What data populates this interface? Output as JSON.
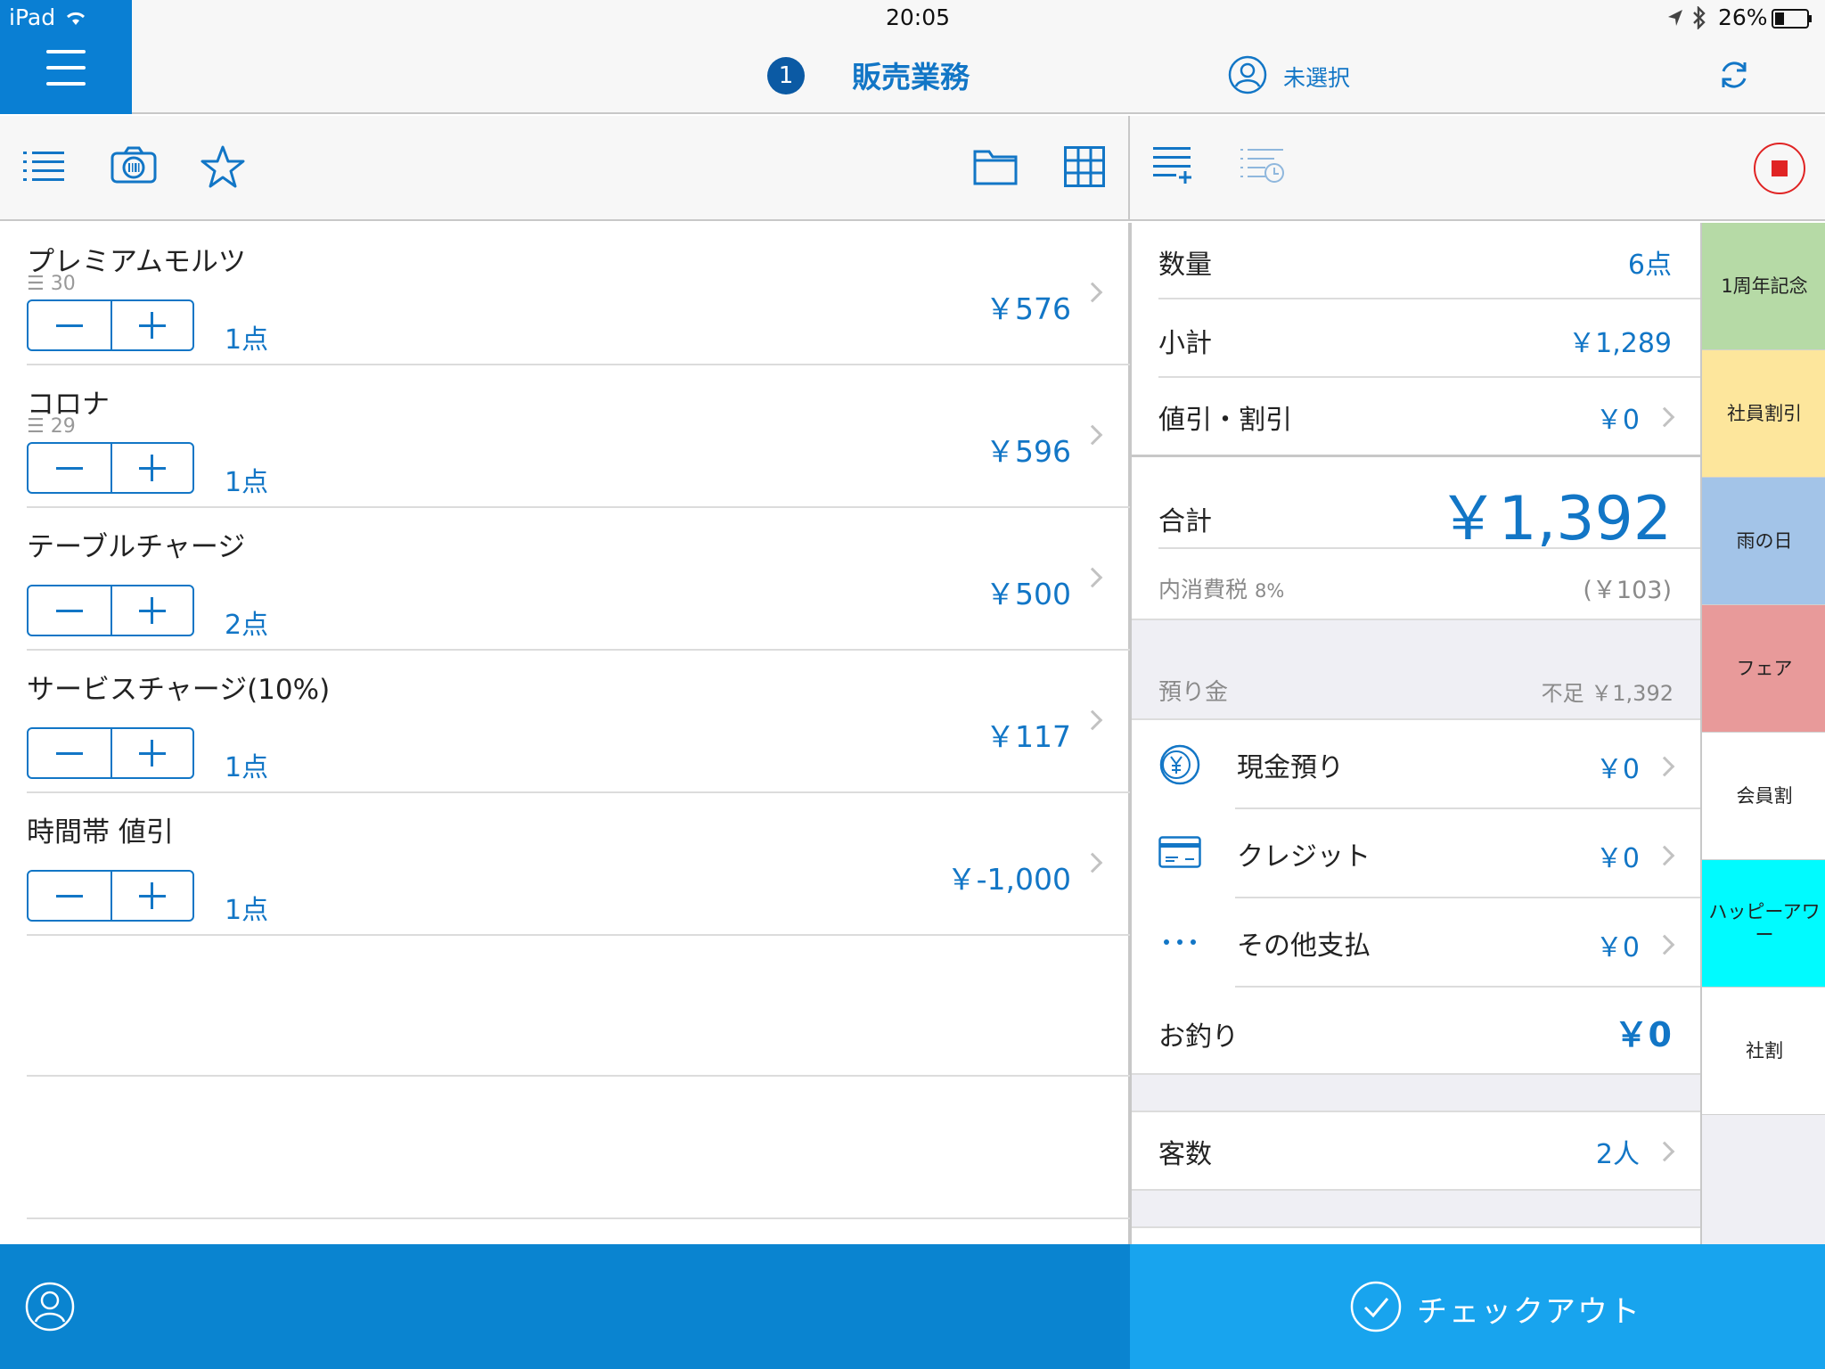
{
  "status_bar": {
    "device": "iPad",
    "time": "20:05",
    "battery": "26%"
  },
  "header": {
    "register_number": "1",
    "title": "販売業務",
    "staff": "未選択"
  },
  "items": [
    {
      "name": "プレミアムモルツ",
      "stock": "30",
      "qty": "1点",
      "price": "￥576"
    },
    {
      "name": "コロナ",
      "stock": "29",
      "qty": "1点",
      "price": "￥596"
    },
    {
      "name": "テーブルチャージ",
      "stock": "",
      "qty": "2点",
      "price": "￥500"
    },
    {
      "name": "サービスチャージ(10%)",
      "stock": "",
      "qty": "1点",
      "price": "￥117"
    },
    {
      "name": "時間帯 値引",
      "stock": "",
      "qty": "1点",
      "price": "￥-1,000"
    }
  ],
  "summary": {
    "quantity_label": "数量",
    "quantity_value": "6点",
    "subtotal_label": "小計",
    "subtotal_value": "￥1,289",
    "discount_label": "値引・割引",
    "discount_value": "￥0",
    "total_label": "合計",
    "total_value": "￥1,392",
    "tax_label": "内消費税",
    "tax_rate": "8%",
    "tax_value": "(￥103)",
    "deposit_label": "預り金",
    "deposit_status": "不足 ￥1,392",
    "payments": [
      {
        "label": "現金預り",
        "value": "￥0",
        "icon": "yen-coin-icon"
      },
      {
        "label": "クレジット",
        "value": "￥0",
        "icon": "credit-card-icon"
      },
      {
        "label": "その他支払",
        "value": "￥0",
        "icon": "more-dots-icon"
      }
    ],
    "change_label": "お釣り",
    "change_value": "￥0",
    "guests_label": "客数",
    "guests_value": "2人"
  },
  "presets": [
    {
      "label": "1周年記念",
      "color": "#b6daa6"
    },
    {
      "label": "社員割引",
      "color": "#fde69c"
    },
    {
      "label": "雨の日",
      "color": "#a3c4e8"
    },
    {
      "label": "フェア",
      "color": "#e89a9a"
    },
    {
      "label": "会員割",
      "color": "#ffffff"
    },
    {
      "label": "ハッピーアワー",
      "color": "#00fbff"
    },
    {
      "label": "社割",
      "color": "#ffffff"
    }
  ],
  "checkout": {
    "label": "チェックアウト"
  },
  "colors": {
    "accent": "#1276c6",
    "nav_blue": "#0a7fd3",
    "checkout_blue": "#18a4ee",
    "record_red": "#e02424"
  }
}
